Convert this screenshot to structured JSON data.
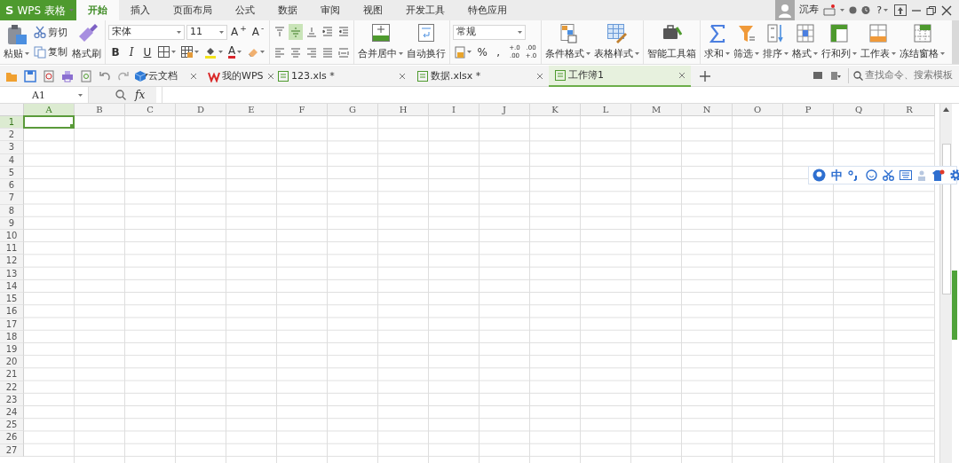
{
  "app_button": {
    "mark": "S",
    "label": "WPS 表格"
  },
  "menu_tabs": [
    {
      "label": "开始",
      "selected": true
    },
    {
      "label": "插入",
      "selected": false
    },
    {
      "label": "页面布局",
      "selected": false
    },
    {
      "label": "公式",
      "selected": false
    },
    {
      "label": "数据",
      "selected": false
    },
    {
      "label": "审阅",
      "selected": false
    },
    {
      "label": "视图",
      "selected": false
    },
    {
      "label": "开发工具",
      "selected": false
    },
    {
      "label": "特色应用",
      "selected": false
    }
  ],
  "account": {
    "name": "沉寿",
    "help": "?"
  },
  "clipboard": {
    "paste": "粘贴",
    "cut": "剪切",
    "copy": "复制",
    "format_painter": "格式刷"
  },
  "font": {
    "family": "宋体",
    "size": "11",
    "grow": "A$^{+}$",
    "shrink": "A$^{-}$",
    "bold": "B",
    "italic": "I",
    "underline": "U",
    "color_button": "A"
  },
  "alignment": [
    {
      "selected": false
    },
    {
      "selected": true
    },
    {
      "selected": false
    },
    {
      "selected": false
    },
    {
      "selected": false
    },
    {
      "selected": false
    },
    {
      "selected": false
    },
    {
      "selected": false
    },
    {
      "selected": false
    },
    {
      "selected": false
    }
  ],
  "merge": "合并居中",
  "wrap": "自动换行",
  "number": {
    "format": "常规",
    "percent": "%",
    "comma": ",",
    "decimals": [
      {
        "top": "+.0",
        "bottom": ".00"
      },
      {
        "top": ".00",
        "bottom": "+.0"
      }
    ]
  },
  "styles": [
    "条件格式",
    "表格样式"
  ],
  "toolbox": "智能工具箱",
  "editing": [
    "求和",
    "筛选",
    "排序",
    "格式",
    "行和列",
    "工作表",
    "冻结窗格"
  ],
  "doc_tabs": [
    {
      "label": "云文档",
      "selected": false
    },
    {
      "label": "我的WPS",
      "selected": false
    },
    {
      "label": "123.xls *",
      "selected": false
    },
    {
      "label": "数据.xlsx *",
      "selected": false
    },
    {
      "label": "工作簿1",
      "selected": true
    }
  ],
  "search": {
    "placeholder": "查找命令、搜索模板"
  },
  "formula_bar": {
    "name_box": "A1",
    "fx": "fx"
  },
  "sheet": {
    "columns": [
      {
        "label": "A",
        "selected": true
      },
      {
        "label": "B",
        "selected": false
      },
      {
        "label": "C",
        "selected": false
      },
      {
        "label": "D",
        "selected": false
      },
      {
        "label": "E",
        "selected": false
      },
      {
        "label": "F",
        "selected": false
      },
      {
        "label": "G",
        "selected": false
      },
      {
        "label": "H",
        "selected": false
      },
      {
        "label": "I",
        "selected": false
      },
      {
        "label": "J",
        "selected": false
      },
      {
        "label": "K",
        "selected": false
      },
      {
        "label": "L",
        "selected": false
      },
      {
        "label": "M",
        "selected": false
      },
      {
        "label": "N",
        "selected": false
      },
      {
        "label": "O",
        "selected": false
      },
      {
        "label": "P",
        "selected": false
      },
      {
        "label": "Q",
        "selected": false
      },
      {
        "label": "R",
        "selected": false
      }
    ],
    "rows": [
      {
        "label": "1",
        "selected": true
      },
      {
        "label": "2",
        "selected": false
      },
      {
        "label": "3",
        "selected": false
      },
      {
        "label": "4",
        "selected": false
      },
      {
        "label": "5",
        "selected": false
      },
      {
        "label": "6",
        "selected": false
      },
      {
        "label": "7",
        "selected": false
      },
      {
        "label": "8",
        "selected": false
      },
      {
        "label": "9",
        "selected": false
      },
      {
        "label": "10",
        "selected": false
      },
      {
        "label": "11",
        "selected": false
      },
      {
        "label": "12",
        "selected": false
      },
      {
        "label": "13",
        "selected": false
      },
      {
        "label": "14",
        "selected": false
      },
      {
        "label": "15",
        "selected": false
      },
      {
        "label": "16",
        "selected": false
      },
      {
        "label": "17",
        "selected": false
      },
      {
        "label": "18",
        "selected": false
      },
      {
        "label": "19",
        "selected": false
      },
      {
        "label": "20",
        "selected": false
      },
      {
        "label": "21",
        "selected": false
      },
      {
        "label": "22",
        "selected": false
      },
      {
        "label": "23",
        "selected": false
      },
      {
        "label": "24",
        "selected": false
      },
      {
        "label": "25",
        "selected": false
      },
      {
        "label": "26",
        "selected": false
      },
      {
        "label": "27",
        "selected": false
      }
    ]
  },
  "ime_bar": {
    "mode": "中"
  }
}
